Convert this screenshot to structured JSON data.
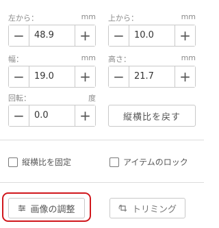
{
  "fields": {
    "left": {
      "label": "左から：",
      "unit": "mm",
      "value": "48.9"
    },
    "top": {
      "label": "上から：",
      "unit": "mm",
      "value": "10.0"
    },
    "width": {
      "label": "幅：",
      "unit": "mm",
      "value": "19.0"
    },
    "height": {
      "label": "高さ：",
      "unit": "mm",
      "value": "21.7"
    },
    "rotate": {
      "label": "回転：",
      "unit": "度",
      "value": "0.0"
    }
  },
  "stepper": {
    "minus": "−",
    "plus": "+"
  },
  "reset_aspect_label": "縦横比を戻す",
  "checkboxes": {
    "lock_aspect": {
      "label": "縦横比を固定",
      "checked": false
    },
    "lock_item": {
      "label": "アイテムのロック",
      "checked": false
    }
  },
  "actions": {
    "adjust_label": "画像の調整",
    "trim_label": "トリミング"
  },
  "colors": {
    "highlight": "#d0161b",
    "border": "#c8c8c8"
  }
}
